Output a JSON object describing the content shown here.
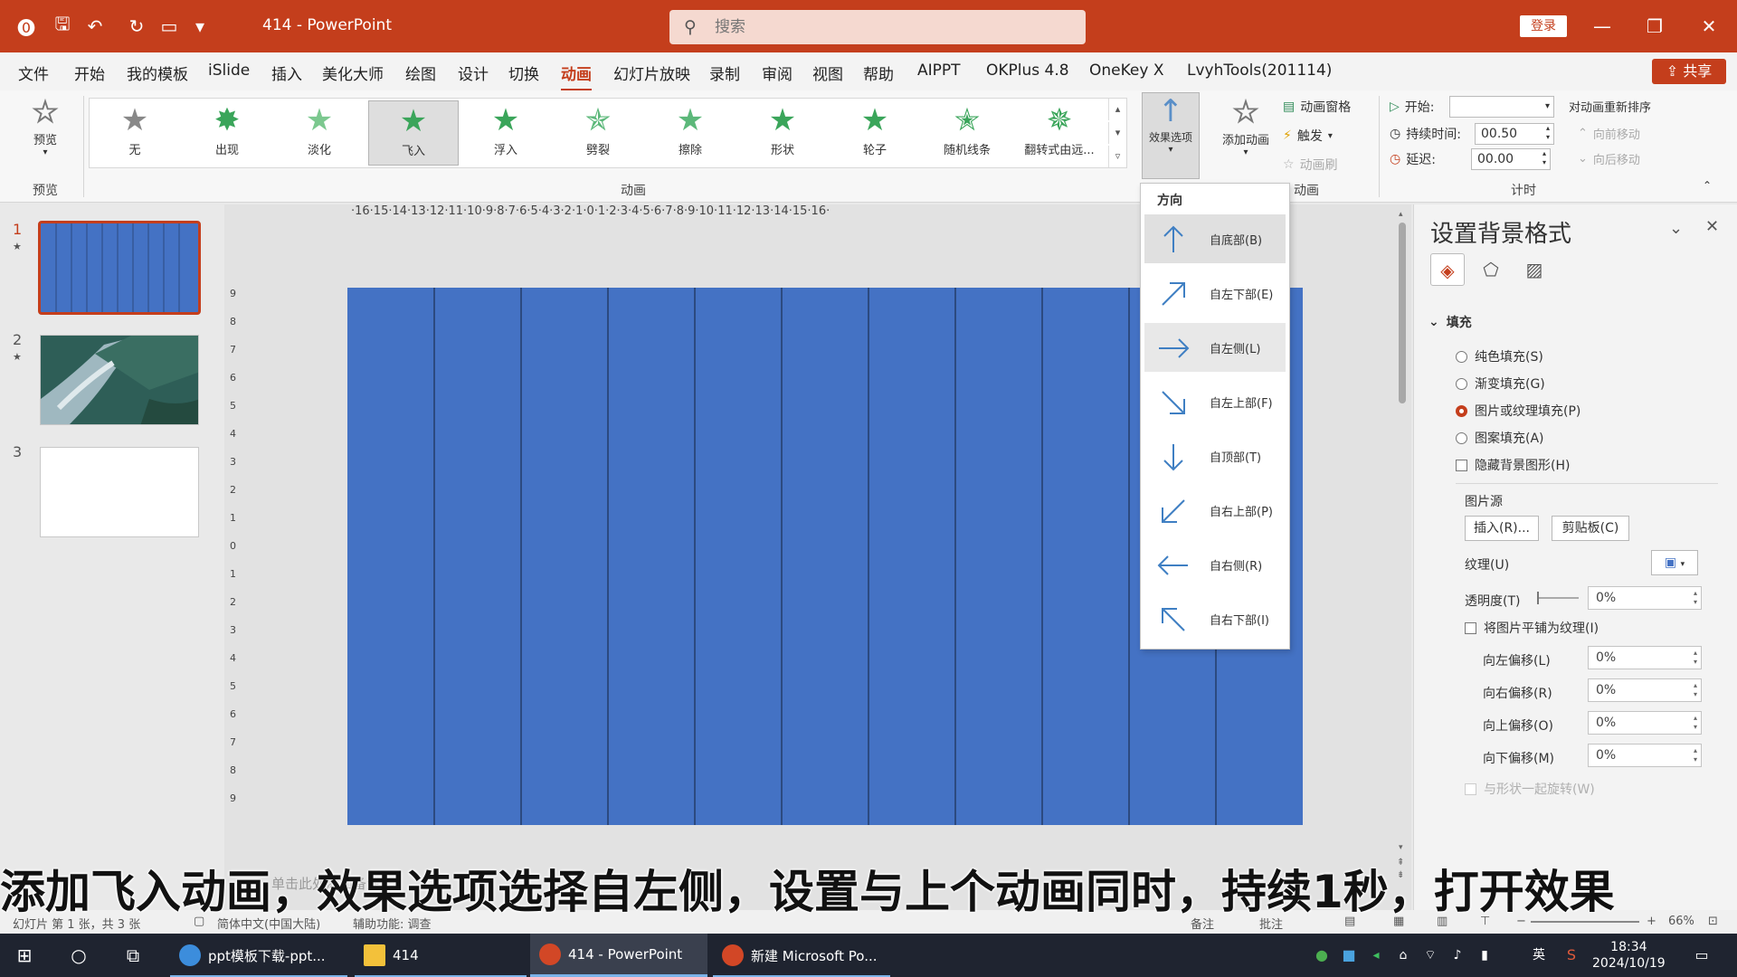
{
  "titlebar": {
    "doc_title": "414 - PowerPoint",
    "search_placeholder": "搜索",
    "login_label": "登录",
    "minimize_label": "—",
    "restore_label": "❐",
    "close_label": "✕"
  },
  "menu": {
    "tabs": [
      "文件",
      "开始",
      "我的模板",
      "iSlide",
      "插入",
      "美化大师",
      "绘图",
      "设计",
      "切换",
      "动画",
      "幻灯片放映",
      "录制",
      "审阅",
      "视图",
      "帮助",
      "AIPPT",
      "OKPlus 4.8",
      "OneKey X",
      "LvyhTools(201114)"
    ],
    "active": "动画",
    "share_label": "共享"
  },
  "ribbon": {
    "preview_label": "预览",
    "preview_group": "预览",
    "animation_group": "动画",
    "advanced_group": "动画",
    "timing_group": "计时",
    "animations": [
      "无",
      "出现",
      "淡化",
      "飞入",
      "浮入",
      "劈裂",
      "擦除",
      "形状",
      "轮子",
      "随机线条",
      "翻转式由远..."
    ],
    "selected_animation": "飞入",
    "effect_options_label": "效果选项",
    "add_animation_label": "添加动画",
    "animation_pane_label": "动画窗格",
    "trigger_label": "触发",
    "painter_label": "动画刷",
    "start_label": "开始:",
    "start_value": "",
    "duration_label": "持续时间:",
    "duration_value": "00.50",
    "delay_label": "延迟:",
    "delay_value": "00.00",
    "reorder_label": "对动画重新排序",
    "move_earlier_label": "向前移动",
    "move_later_label": "向后移动"
  },
  "thumbnails": [
    {
      "num": "1",
      "star": "★"
    },
    {
      "num": "2",
      "star": "★"
    },
    {
      "num": "3",
      "star": ""
    }
  ],
  "ruler": {
    "horizontal": "·16·15·14·13·12·11·10·9·8·7·6·5·4·3·2·1·0·1·2·3·4·5·6·7·8·9·10·11·12·13·14·15·16·",
    "vertical": [
      "9",
      "8",
      "7",
      "6",
      "5",
      "4",
      "3",
      "2",
      "1",
      "0",
      "1",
      "2",
      "3",
      "4",
      "5",
      "6",
      "7",
      "8",
      "9"
    ]
  },
  "direction_menu": {
    "header": "方向",
    "items": [
      {
        "label": "自底部(B)",
        "icon": "arrow-up-icon"
      },
      {
        "label": "自左下部(E)",
        "icon": "arrow-up-right-icon"
      },
      {
        "label": "自左侧(L)",
        "icon": "arrow-right-icon"
      },
      {
        "label": "自左上部(F)",
        "icon": "arrow-down-right-icon"
      },
      {
        "label": "自顶部(T)",
        "icon": "arrow-down-icon"
      },
      {
        "label": "自右上部(P)",
        "icon": "arrow-down-left-icon"
      },
      {
        "label": "自右侧(R)",
        "icon": "arrow-left-icon"
      },
      {
        "label": "自右下部(I)",
        "icon": "arrow-up-left-icon"
      }
    ],
    "hovered": "自左侧(L)"
  },
  "format_pane": {
    "title": "设置背景格式",
    "fill_section": "填充",
    "options": [
      {
        "label": "纯色填充(S)",
        "type": "radio",
        "checked": false
      },
      {
        "label": "渐变填充(G)",
        "type": "radio",
        "checked": false
      },
      {
        "label": "图片或纹理填充(P)",
        "type": "radio",
        "checked": true
      },
      {
        "label": "图案填充(A)",
        "type": "radio",
        "checked": false
      },
      {
        "label": "隐藏背景图形(H)",
        "type": "check",
        "checked": false
      }
    ],
    "picture_source_label": "图片源",
    "insert_label": "插入(R)...",
    "clipboard_label": "剪贴板(C)",
    "texture_label": "纹理(U)",
    "transparency_label": "透明度(T)",
    "transparency_value": "0%",
    "tile_label": "将图片平铺为纹理(I)",
    "offsets": [
      {
        "label": "向左偏移(L)",
        "value": "0%"
      },
      {
        "label": "向右偏移(R)",
        "value": "0%"
      },
      {
        "label": "向上偏移(O)",
        "value": "0%"
      },
      {
        "label": "向下偏移(M)",
        "value": "0%"
      }
    ],
    "rotate_label": "与形状一起旋转(W)"
  },
  "statusbar": {
    "slide_info": "幻灯片 第 1 张，共 3 张",
    "language": "简体中文(中国大陆)",
    "accessibility": "辅助功能: 调查",
    "notes": "备注",
    "comments": "批注",
    "zoom": "66%",
    "notes_placeholder": "单击此处添加备注"
  },
  "subtitle": "添加飞入动画，效果选项选择自左侧，设置与上个动画同时，持续1秒，打开效果",
  "taskbar": {
    "apps": [
      {
        "label": "ppt模板下载-ppt...",
        "active": false
      },
      {
        "label": "414",
        "active": false
      },
      {
        "label": "414 - PowerPoint",
        "active": true
      },
      {
        "label": "新建 Microsoft Po...",
        "active": false
      }
    ],
    "ime": "英",
    "time": "18:34",
    "date": "2024/10/19"
  },
  "colors": {
    "accent": "#c43e1c",
    "slide_fill": "#4472c4",
    "stripe": "#2c4a80",
    "star_green": "#3aa55a"
  }
}
